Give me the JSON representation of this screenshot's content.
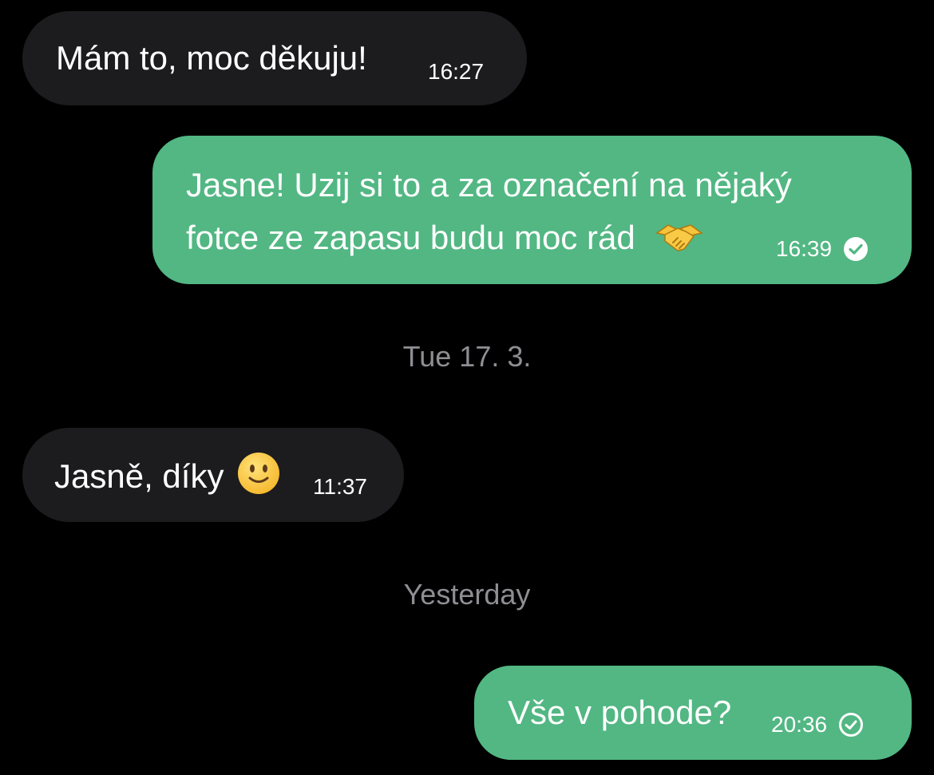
{
  "conversation": {
    "messages": [
      {
        "direction": "incoming",
        "text": "Mám to, moc děkuju!",
        "time": "16:27"
      },
      {
        "direction": "outgoing",
        "line1": "Jasne! Uzij si to a za označení na nějaký",
        "line2": "fotce ze zapasu budu moc rád",
        "emoji": "handshake-emoji",
        "time": "16:39",
        "status": "read",
        "status_icon": "filled-check-circle-icon"
      },
      {
        "direction": "incoming",
        "text": "Jasně, díky",
        "emoji": "slightly-smiling-face-emoji",
        "time": "11:37"
      },
      {
        "direction": "outgoing",
        "text": "Vše v pohode?",
        "time": "20:36",
        "status": "sent",
        "status_icon": "outline-check-circle-icon"
      }
    ],
    "date_separators": [
      {
        "label": "Tue 17. 3."
      },
      {
        "label": "Yesterday"
      }
    ]
  },
  "colors": {
    "background": "#000000",
    "incoming_bubble": "#1c1c1e",
    "outgoing_bubble": "#52b783",
    "separator_text": "#8e8e93"
  }
}
